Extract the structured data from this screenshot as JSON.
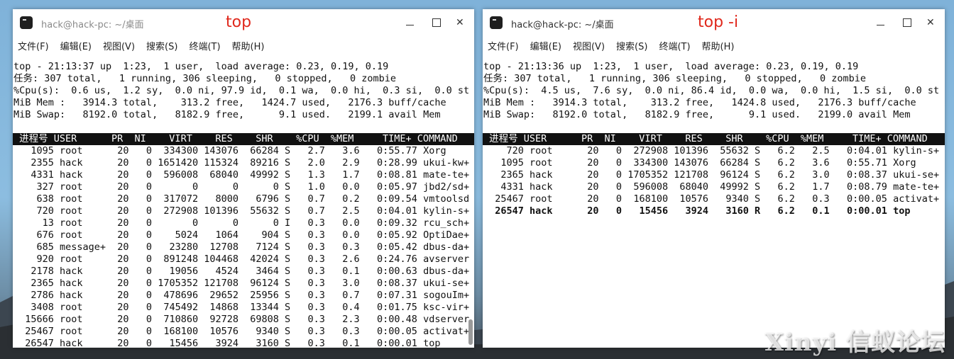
{
  "left_window": {
    "title": "hack@hack-pc: ~/桌面",
    "annotation": "top",
    "menu": [
      "文件(F)",
      "编辑(E)",
      "视图(V)",
      "搜索(S)",
      "终端(T)",
      "帮助(H)"
    ],
    "summary": [
      "top - 21:13:37 up  1:23,  1 user,  load average: 0.23, 0.19, 0.19",
      "任务: 307 total,   1 running, 306 sleeping,   0 stopped,   0 zombie",
      "%Cpu(s):  0.6 us,  1.2 sy,  0.0 ni, 97.9 id,  0.1 wa,  0.0 hi,  0.3 si,  0.0 st",
      "MiB Mem :   3914.3 total,    313.2 free,   1424.7 used,   2176.3 buff/cache",
      "MiB Swap:   8192.0 total,   8182.9 free,      9.1 used.   2199.1 avail Mem"
    ],
    "header": " 进程号 USER      PR  NI    VIRT    RES    SHR    %CPU  %MEM     TIME+ COMMAND",
    "rows": [
      "   1095 root      20   0  334300 143076  66284 S   2.7   3.6   0:55.77 Xorg",
      "   2355 hack      20   0 1651420 115324  89216 S   2.0   2.9   0:28.99 ukui-kw+",
      "   4331 hack      20   0  596008  68040  49992 S   1.3   1.7   0:08.81 mate-te+",
      "    327 root      20   0       0      0      0 S   1.0   0.0   0:05.97 jbd2/sd+",
      "    638 root      20   0  317072   8000   6796 S   0.7   0.2   0:09.54 vmtoolsd",
      "    720 root      20   0  272908 101396  55632 S   0.7   2.5   0:04.01 kylin-s+",
      "     13 root      20   0       0      0      0 I   0.3   0.0   0:09.32 rcu_sch+",
      "    676 root      20   0    5024   1064    904 S   0.3   0.0   0:05.92 OptiDae+",
      "    685 message+  20   0   23280  12708   7124 S   0.3   0.3   0:05.42 dbus-da+",
      "    920 root      20   0  891248 104468  42024 S   0.3   2.6   0:24.76 avserver",
      "   2178 hack      20   0   19056   4524   3464 S   0.3   0.1   0:00.63 dbus-da+",
      "   2365 hack      20   0 1705352 121708  96124 S   0.3   3.0   0:08.37 ukui-se+",
      "   2786 hack      20   0  478696  29652  25956 S   0.3   0.7   0:07.31 sogouIm+",
      "   3408 root      20   0  745492  14868  13344 S   0.3   0.4   0:01.75 ksc-vir+",
      "  15666 root      20   0  710860  92728  69808 S   0.3   2.3   0:00.48 vdserver",
      "  25467 root      20   0  168100  10576   9340 S   0.3   0.3   0:00.05 activat+",
      "  26547 hack      20   0   15456   3924   3160 S   0.3   0.1   0:00.01 top"
    ]
  },
  "right_window": {
    "title": "hack@hack-pc: ~/桌面",
    "annotation": "top -i",
    "menu": [
      "文件(F)",
      "编辑(E)",
      "视图(V)",
      "搜索(S)",
      "终端(T)",
      "帮助(H)"
    ],
    "summary": [
      "top - 21:13:36 up  1:23,  1 user,  load average: 0.23, 0.19, 0.19",
      "任务: 307 total,   1 running, 306 sleeping,   0 stopped,   0 zombie",
      "%Cpu(s):  4.5 us,  7.6 sy,  0.0 ni, 86.4 id,  0.0 wa,  0.0 hi,  1.5 si,  0.0 st",
      "MiB Mem :   3914.3 total,    313.2 free,   1424.8 used,   2176.3 buff/cache",
      "MiB Swap:   8192.0 total,   8182.9 free,      9.1 used.   2199.0 avail Mem"
    ],
    "header": " 进程号 USER      PR  NI    VIRT    RES    SHR    %CPU  %MEM     TIME+ COMMAND",
    "rows": [
      "    720 root      20   0  272908 101396  55632 S   6.2   2.5   0:04.01 kylin-s+",
      "   1095 root      20   0  334300 143076  66284 S   6.2   3.6   0:55.71 Xorg",
      "   2365 hack      20   0 1705352 121708  96124 S   6.2   3.0   0:08.37 ukui-se+",
      "   4331 hack      20   0  596008  68040  49992 S   6.2   1.7   0:08.79 mate-te+",
      "  25467 root      20   0  168100  10576   9340 S   6.2   0.3   0:00.05 activat+",
      "  26547 hack      20   0   15456   3924   3160 R   6.2   0.1   0:00.01 top"
    ]
  },
  "watermark": "Xinyi 信蚁论坛"
}
